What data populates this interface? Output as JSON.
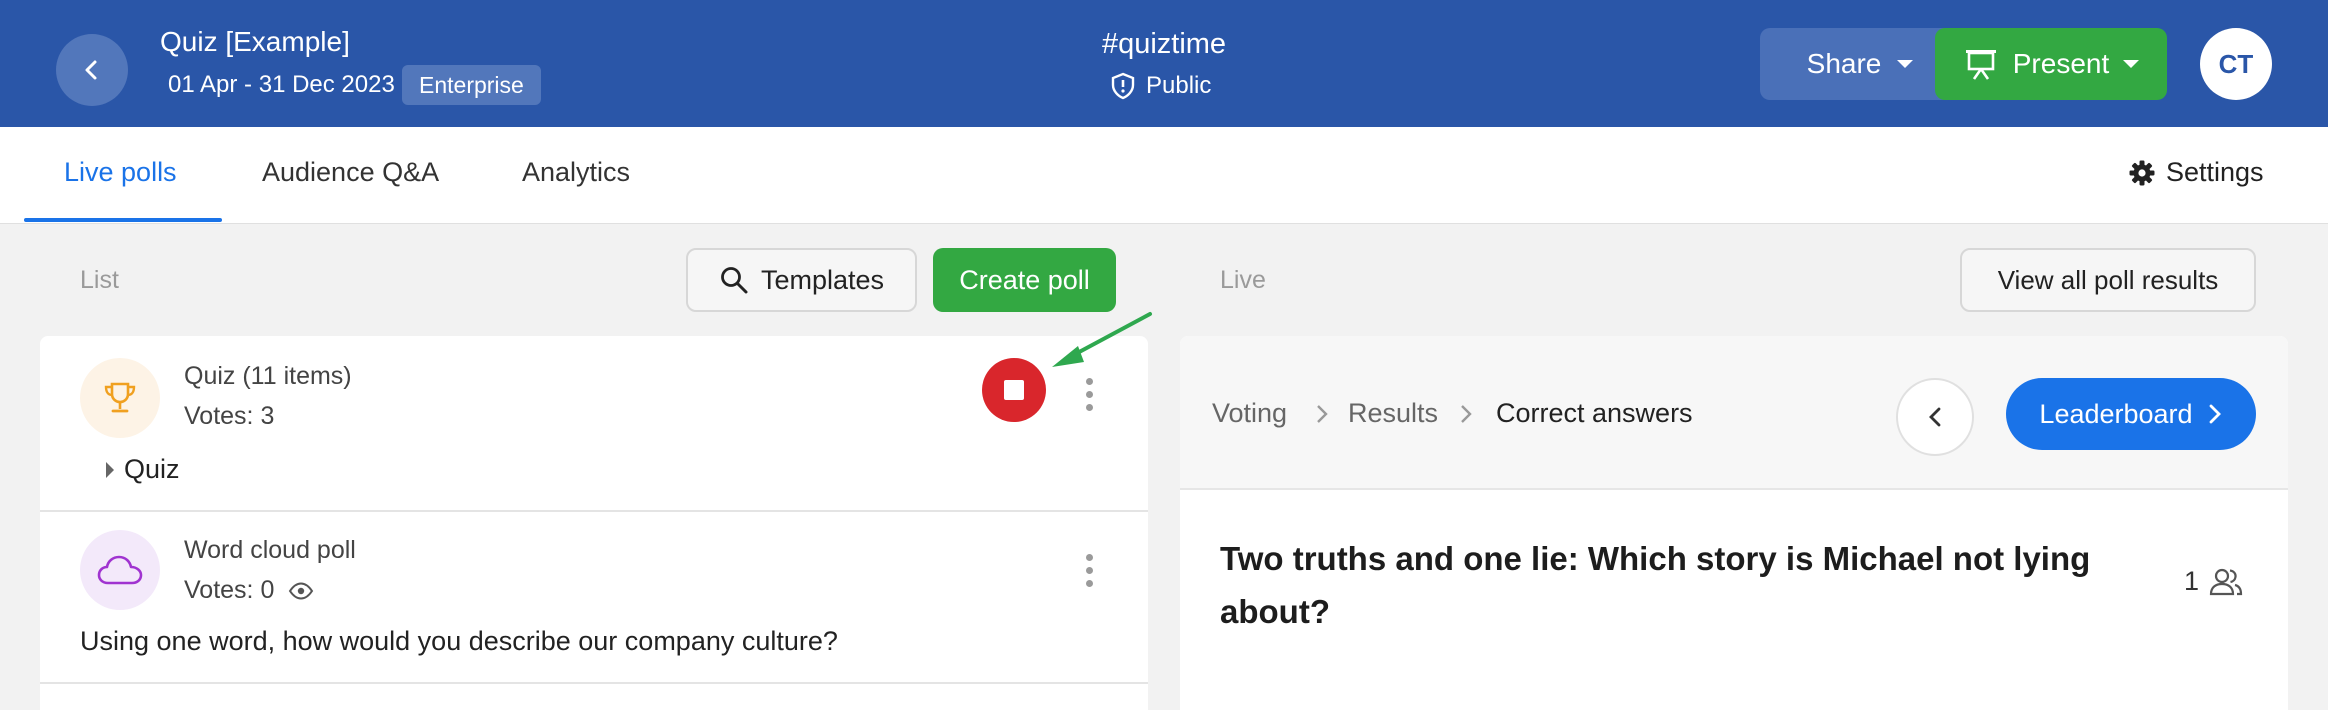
{
  "header": {
    "event_title": "Quiz [Example]",
    "event_dates": "01 Apr - 31 Dec 2023",
    "plan_badge": "Enterprise",
    "event_code": "#quiztime",
    "privacy": "Public",
    "share_label": "Share",
    "present_label": "Present",
    "avatar_initials": "CT"
  },
  "tabs": [
    {
      "label": "Live polls",
      "active": true
    },
    {
      "label": "Audience Q&A",
      "active": false
    },
    {
      "label": "Analytics",
      "active": false
    }
  ],
  "settings_label": "Settings",
  "left_panel": {
    "label": "List",
    "templates_label": "Templates",
    "create_poll_label": "Create poll",
    "polls": [
      {
        "type": "Quiz (11 items)",
        "votes": "Votes: 3",
        "title": "Quiz",
        "icon": "trophy-icon",
        "status": "live"
      },
      {
        "type": "Word cloud poll",
        "votes": "Votes: 0",
        "title": "Using one word, how would you describe our company culture?",
        "icon": "cloud-icon",
        "status": "inactive"
      }
    ]
  },
  "right_panel": {
    "label": "Live",
    "view_all_label": "View all poll results",
    "breadcrumb": [
      "Voting",
      "Results",
      "Correct answers"
    ],
    "leaderboard_label": "Leaderboard",
    "question": "Two truths and one lie: Which story is Michael not lying about?",
    "participants": "1"
  },
  "colors": {
    "header_bg": "#2a56a8",
    "accent_blue": "#1a73e8",
    "green": "#33a842",
    "stop_red": "#d9262c",
    "annotation_arrow": "#2fa84f"
  }
}
